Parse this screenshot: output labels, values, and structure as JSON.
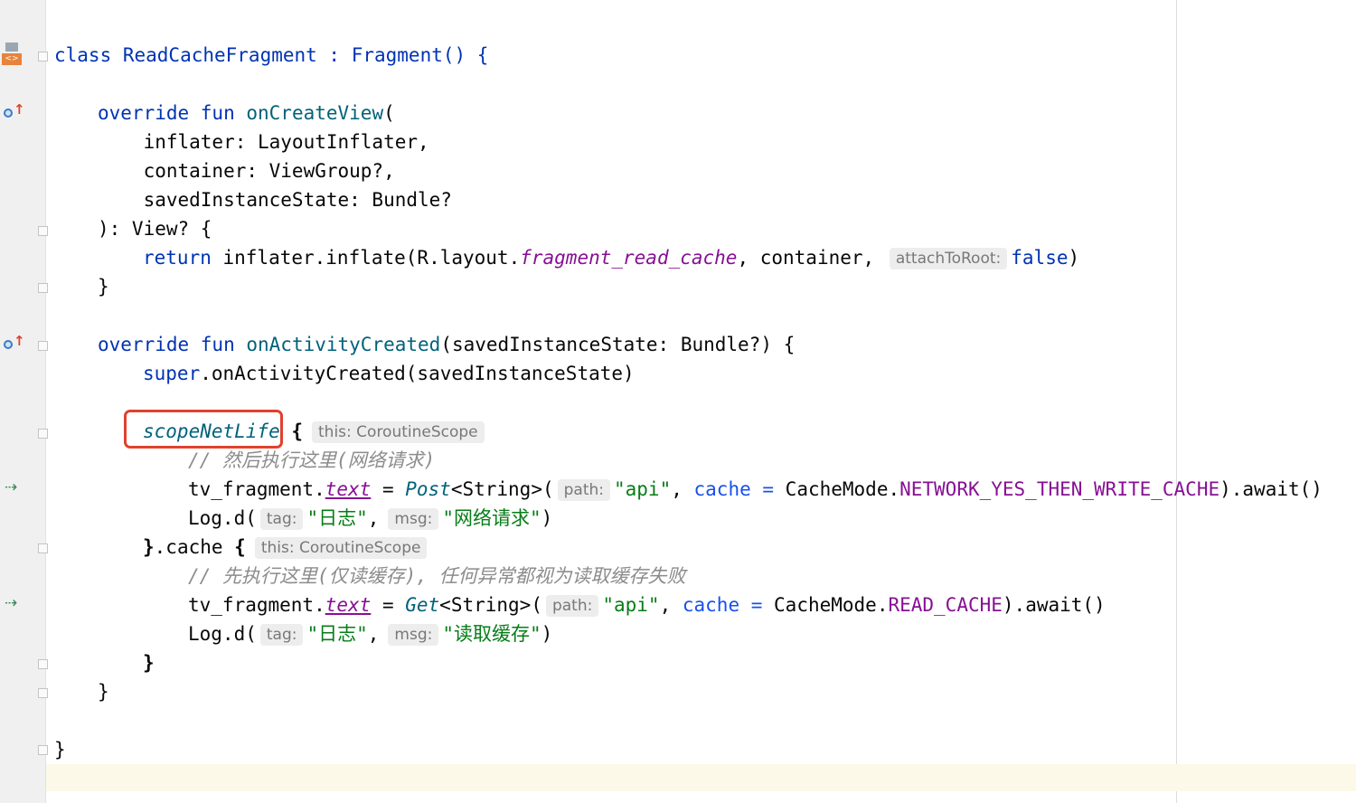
{
  "gutter": {
    "icons": [
      "class-icon",
      "override-icon",
      "override-icon",
      "run-icon",
      "run-icon",
      "fold-icon"
    ]
  },
  "code": {
    "line_class": "class ReadCacheFragment : Fragment() {",
    "l_override1_kw": "override fun ",
    "l_override1_fn": "onCreateView",
    "l_override1_rest": "(",
    "l_param1": "    inflater: LayoutInflater,",
    "l_param2": "    container: ViewGroup?,",
    "l_param3": "    savedInstanceState: Bundle?",
    "l_ret": "): View? {",
    "l_return_kw": "return",
    "l_return_mid": " inflater.inflate(R.layout.",
    "l_return_res": "fragment_read_cache",
    "l_return_rest": ", container, ",
    "l_return_hint": "attachToRoot:",
    "l_return_false": "false",
    "l_return_end": ")",
    "l_close1": "}",
    "l_override2_kw": "override fun ",
    "l_override2_fn": "onActivityCreated",
    "l_override2_rest": "(savedInstanceState: Bundle?) {",
    "l_super_kw": "super",
    "l_super_rest": ".onActivityCreated(savedInstanceState)",
    "l_scope_fn": "scopeNetLife",
    "l_scope_brace": " {",
    "l_scope_hint": "this: CoroutineScope",
    "l_cmt1": "// 然后执行这里(网络请求)",
    "l_tv1_pre": "tv_fragment.",
    "l_tv1_prop": "text",
    "l_tv1_eq": " = ",
    "l_tv1_fn": "Post",
    "l_tv1_gen": "<String>(",
    "l_tv1_hint": "path:",
    "l_tv1_str": "\"api\"",
    "l_tv1_comma": ", ",
    "l_tv1_named": "cache =",
    "l_tv1_mode": " CacheMode.",
    "l_tv1_const": "NETWORK_YES_THEN_WRITE_CACHE",
    "l_tv1_end": ").await()",
    "l_log1_pre": "Log.d(",
    "l_log1_tag_hint": "tag:",
    "l_log1_tag": "\"日志\"",
    "l_log1_comma": ",",
    "l_log1_msg_hint": "msg:",
    "l_log1_msg": "\"网络请求\"",
    "l_log1_end": ")",
    "l_cache_pre": "}",
    "l_cache_mid": ".cache ",
    "l_cache_brace": "{",
    "l_cache_hint": "this: CoroutineScope",
    "l_cmt2": "// 先执行这里(仅读缓存), 任何异常都视为读取缓存失败",
    "l_tv2_pre": "tv_fragment.",
    "l_tv2_prop": "text",
    "l_tv2_eq": " = ",
    "l_tv2_fn": "Get",
    "l_tv2_gen": "<String>(",
    "l_tv2_hint": "path:",
    "l_tv2_str": "\"api\"",
    "l_tv2_comma": ", ",
    "l_tv2_named": "cache =",
    "l_tv2_mode": " CacheMode.",
    "l_tv2_const": "READ_CACHE",
    "l_tv2_end": ").await()",
    "l_log2_pre": "Log.d(",
    "l_log2_tag_hint": "tag:",
    "l_log2_tag": "\"日志\"",
    "l_log2_comma": ",",
    "l_log2_msg_hint": "msg:",
    "l_log2_msg": "\"读取缓存\"",
    "l_log2_end": ")",
    "l_close_inner": "}",
    "l_close_fun": "}",
    "l_close_class": "}"
  },
  "colors": {
    "keyword": "#0033b3",
    "function": "#00627a",
    "string": "#067d17",
    "constant": "#871094",
    "comment": "#8c8c8c",
    "highlight_box": "#e0412d",
    "current_line": "#fcf9e9"
  }
}
